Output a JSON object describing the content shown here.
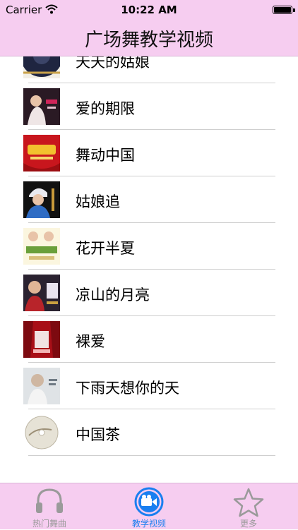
{
  "status_bar": {
    "carrier": "Carrier",
    "time": "10:22 AM"
  },
  "nav": {
    "title": "广场舞教学视频"
  },
  "list": {
    "items": [
      {
        "label": "天天的姑娘",
        "thumb_icon": "cd-disc-thumbnail"
      },
      {
        "label": "爱的期限",
        "thumb_icon": "singer-photo-thumbnail"
      },
      {
        "label": "舞动中国",
        "thumb_icon": "red-banner-thumbnail"
      },
      {
        "label": "姑娘追",
        "thumb_icon": "singer-portrait-thumbnail"
      },
      {
        "label": "花开半夏",
        "thumb_icon": "album-cover-thumbnail"
      },
      {
        "label": "凉山的月亮",
        "thumb_icon": "album-cover-thumbnail"
      },
      {
        "label": "裸爱",
        "thumb_icon": "red-stage-thumbnail"
      },
      {
        "label": "下雨天想你的天",
        "thumb_icon": "album-cover-thumbnail"
      },
      {
        "label": "中国茶",
        "thumb_icon": "cd-disc-thumbnail"
      }
    ]
  },
  "tabs": [
    {
      "label": "热门舞曲",
      "icon": "headphones-icon",
      "active": false
    },
    {
      "label": "教学视频",
      "icon": "video-camera-icon",
      "active": true
    },
    {
      "label": "更多",
      "icon": "star-icon",
      "active": false
    }
  ],
  "colors": {
    "bar_background": "#f6cdf0",
    "active_tab": "#1a7ff0",
    "inactive_tab": "#9a9a9a",
    "separator": "#cfcfcf"
  }
}
